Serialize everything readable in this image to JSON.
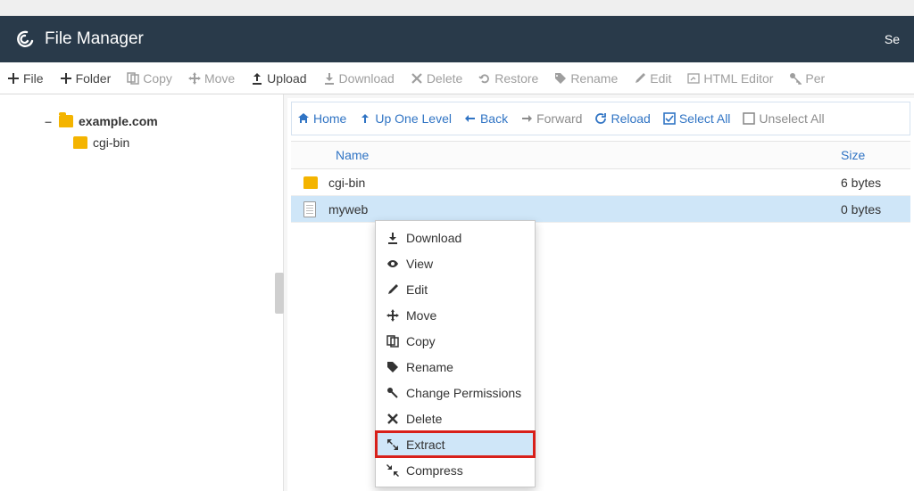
{
  "header": {
    "app_title": "File Manager",
    "right_text_fragment": "Se"
  },
  "toolbar": {
    "file": "File",
    "folder": "Folder",
    "copy": "Copy",
    "move": "Move",
    "upload": "Upload",
    "download": "Download",
    "delete": "Delete",
    "restore": "Restore",
    "rename": "Rename",
    "edit": "Edit",
    "html_editor": "HTML Editor",
    "permissions": "Per"
  },
  "tree": {
    "root_label": "example.com",
    "child": "cgi-bin"
  },
  "nav": {
    "home": "Home",
    "up": "Up One Level",
    "back": "Back",
    "forward": "Forward",
    "reload": "Reload",
    "select_all": "Select All",
    "unselect_all": "Unselect All"
  },
  "table": {
    "col_name": "Name",
    "col_size": "Size",
    "rows": [
      {
        "name": "cgi-bin",
        "size": "6 bytes",
        "type": "folder"
      },
      {
        "name": "myweb",
        "size": "0 bytes",
        "type": "file",
        "selected": true,
        "name_truncated": true
      }
    ]
  },
  "context_menu": {
    "items": [
      {
        "label": "Download",
        "icon": "download-icon"
      },
      {
        "label": "View",
        "icon": "eye-icon"
      },
      {
        "label": "Edit",
        "icon": "pencil-icon"
      },
      {
        "label": "Move",
        "icon": "move-icon"
      },
      {
        "label": "Copy",
        "icon": "copy-icon"
      },
      {
        "label": "Rename",
        "icon": "tag-icon"
      },
      {
        "label": "Change Permissions",
        "icon": "key-icon"
      },
      {
        "label": "Delete",
        "icon": "x-icon"
      },
      {
        "label": "Extract",
        "icon": "expand-icon",
        "highlight": true
      },
      {
        "label": "Compress",
        "icon": "compress-icon"
      }
    ]
  }
}
